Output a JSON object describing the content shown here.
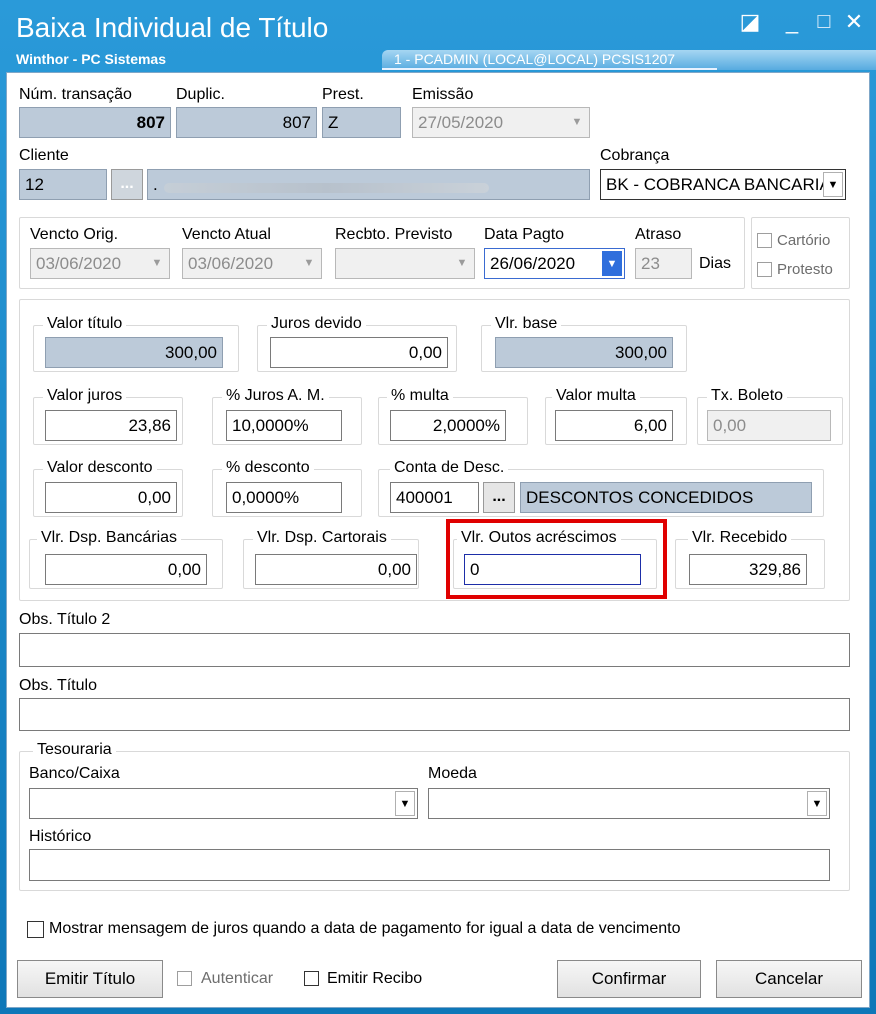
{
  "window": {
    "title": "Baixa Individual de Título",
    "subtitle": "Winthor - PC Sistemas",
    "session": "1 - PCADMIN (LOCAL@LOCAL)   PCSIS1207"
  },
  "header": {
    "num_transacao_label": "Núm. transação",
    "num_transacao": "807",
    "duplic_label": "Duplic.",
    "duplic": "807",
    "prest_label": "Prest.",
    "prest": "Z",
    "emissao_label": "Emissão",
    "emissao": "27/05/2020",
    "cliente_label": "Cliente",
    "cliente_code": "12",
    "ellipsis": "...",
    "cliente_name_sep": ".",
    "cobranca_label": "Cobrança",
    "cobranca": "BK - COBRANCA BANCARIA"
  },
  "dates": {
    "vencto_orig_label": "Vencto Orig.",
    "vencto_orig": "03/06/2020",
    "vencto_atual_label": "Vencto Atual",
    "vencto_atual": "03/06/2020",
    "recbto_label": "Recbto. Previsto",
    "recbto": "",
    "data_pagto_label": "Data Pagto",
    "data_pagto": "26/06/2020",
    "atraso_label": "Atraso",
    "atraso": "23",
    "dias_label": "Dias",
    "cartorio_label": "Cartório",
    "protesto_label": "Protesto"
  },
  "values": {
    "valor_titulo_label": "Valor título",
    "valor_titulo": "300,00",
    "juros_devido_label": "Juros devido",
    "juros_devido": "0,00",
    "vlr_base_label": "Vlr. base",
    "vlr_base": "300,00",
    "valor_juros_label": "Valor juros",
    "valor_juros": "23,86",
    "juros_am_label": "% Juros A. M.",
    "juros_am": "10,0000%",
    "multa_pct_label": "% multa",
    "multa_pct": "2,0000%",
    "valor_multa_label": "Valor multa",
    "valor_multa": "6,00",
    "tx_boleto_label": "Tx. Boleto",
    "tx_boleto": "0,00",
    "valor_desconto_label": "Valor desconto",
    "valor_desconto": "0,00",
    "desconto_pct_label": "% desconto",
    "desconto_pct": "0,0000%",
    "conta_desc_label": "Conta de Desc.",
    "conta_desc_code": "400001",
    "conta_desc_name": "DESCONTOS CONCEDIDOS",
    "dsp_bancarias_label": "Vlr. Dsp. Bancárias",
    "dsp_bancarias": "0,00",
    "dsp_cartorais_label": "Vlr. Dsp. Cartorais",
    "dsp_cartorais": "0,00",
    "outros_acresc_label": "Vlr. Outos acréscimos",
    "outros_acresc": "0",
    "vlr_recebido_label": "Vlr. Recebido",
    "vlr_recebido": "329,86"
  },
  "obs": {
    "obs2_label": "Obs. Título 2",
    "obs2": "",
    "obs_label": "Obs. Título",
    "obs": ""
  },
  "tesouraria": {
    "group_label": "Tesouraria",
    "banco_label": "Banco/Caixa",
    "banco": "",
    "moeda_label": "Moeda",
    "moeda": "",
    "historico_label": "Histórico",
    "historico": ""
  },
  "footer": {
    "mostrar_msg_label": "Mostrar mensagem de juros quando a data de pagamento for igual a data de vencimento",
    "emitir_titulo": "Emitir Título",
    "autenticar": "Autenticar",
    "emitir_recibo": "Emitir Recibo",
    "confirmar": "Confirmar",
    "cancelar": "Cancelar"
  },
  "colors": {
    "highlight": "#e00000",
    "titlebar": "#1a8bcf",
    "readonly_field": "#bccad9"
  }
}
